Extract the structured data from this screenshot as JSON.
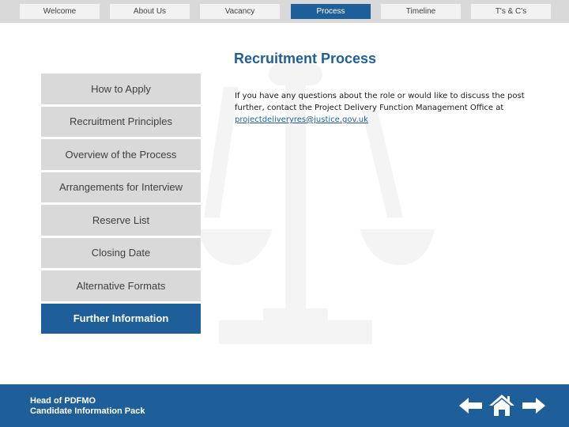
{
  "top_nav": {
    "tabs": [
      {
        "label": "Welcome",
        "active": false
      },
      {
        "label": "About Us",
        "active": false
      },
      {
        "label": "Vacancy",
        "active": false
      },
      {
        "label": "Process",
        "active": true
      },
      {
        "label": "Timeline",
        "active": false
      },
      {
        "label": "T's & C's",
        "active": false
      }
    ]
  },
  "main": {
    "title": "Recruitment Process",
    "body": "If you have any questions about the role or would like to discuss the post further, contact the Project Delivery Function Management Office at",
    "email_link": "projectdeliveryres@justice.gov.uk"
  },
  "sidebar": {
    "items": [
      {
        "label": "How to Apply",
        "active": false
      },
      {
        "label": "Recruitment Principles",
        "active": false
      },
      {
        "label": "Overview of the Process",
        "active": false
      },
      {
        "label": "Arrangements for Interview",
        "active": false
      },
      {
        "label": "Reserve List",
        "active": false
      },
      {
        "label": "Closing Date",
        "active": false
      },
      {
        "label": "Alternative Formats",
        "active": false
      },
      {
        "label": "Further Information",
        "active": true
      }
    ]
  },
  "footer": {
    "line1": "Head of PDFMO",
    "line2": "Candidate Information Pack",
    "icons": [
      "back-arrow-icon",
      "home-icon",
      "forward-arrow-icon"
    ]
  },
  "colors": {
    "brand_blue": "#1f5f99",
    "nav_bar_grey": "#d9d9d9",
    "tab_grey": "#f2f2f2",
    "sidebar_grey": "#d9d9d9"
  }
}
